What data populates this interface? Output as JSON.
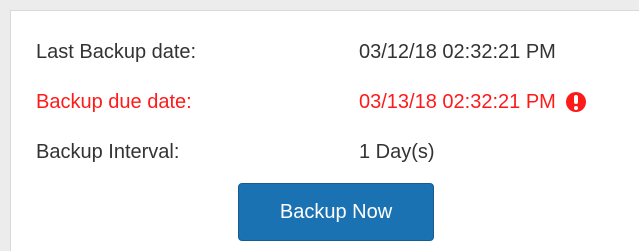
{
  "backup_info": {
    "rows": [
      {
        "label": "Last Backup date:",
        "value": "03/12/18 02:32:21 PM",
        "status": "normal"
      },
      {
        "label": "Backup due date:",
        "value": "03/13/18 02:32:21 PM",
        "status": "overdue",
        "icon": "exclamation-circle-icon"
      },
      {
        "label": "Backup Interval:",
        "value": "1 Day(s)",
        "status": "normal"
      }
    ]
  },
  "actions": {
    "backup_now_label": "Backup Now"
  },
  "colors": {
    "overdue_text": "#ff1a1a",
    "normal_text": "#333333",
    "button_bg": "#1a72b3",
    "button_text": "#ffffff"
  }
}
